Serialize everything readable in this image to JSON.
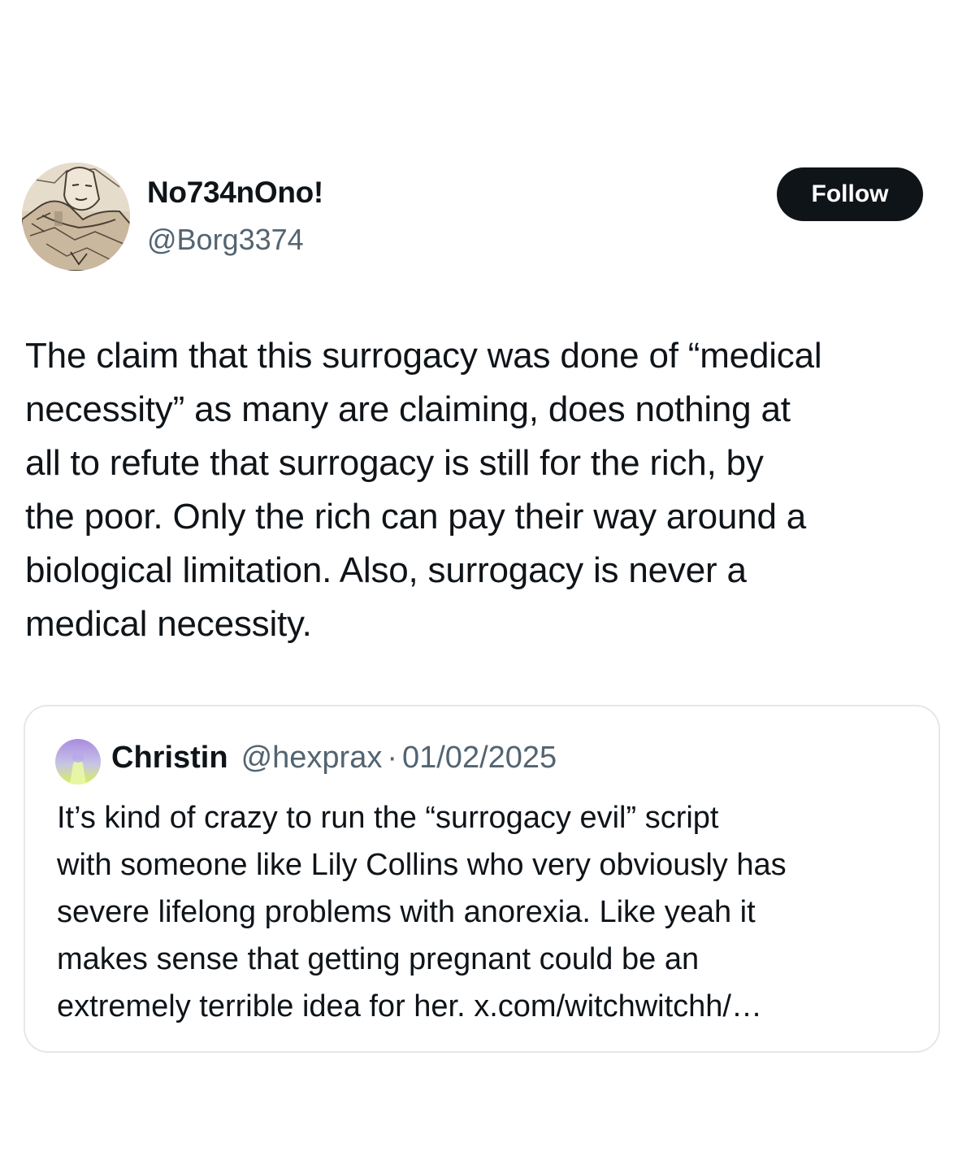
{
  "author": {
    "display_name": "No734nOno!",
    "handle": "@Borg3374"
  },
  "follow_button": {
    "label": "Follow"
  },
  "tweet": {
    "lines": [
      "The claim that this surrogacy was done of “medical",
      "necessity” as many are claiming, does nothing at",
      "all to refute that surrogacy is still for the rich, by",
      "the poor. Only the rich can pay their way around a",
      "biological limitation. Also, surrogacy is never a",
      "medical necessity."
    ]
  },
  "quote": {
    "display_name": "Christin",
    "handle": "@hexprax",
    "separator": "·",
    "date": "01/02/2025",
    "lines": [
      "It’s kind of crazy to run the “surrogacy evil” script",
      "with someone like Lily Collins who very obviously has",
      "severe lifelong problems with anorexia. Like yeah it",
      "makes sense that getting pregnant could be an",
      "extremely terrible idea for her. "
    ],
    "link": "x.com/witchwitchh/…"
  },
  "colors": {
    "text_primary": "#0f1419",
    "text_secondary": "#536471",
    "button_bg": "#0f1419",
    "button_text": "#ffffff",
    "card_border": "#e4e8eb"
  },
  "icons": {
    "author_avatar": "sketch-portrait-avatar",
    "quote_avatar": "purple-green-gradient-avatar"
  }
}
